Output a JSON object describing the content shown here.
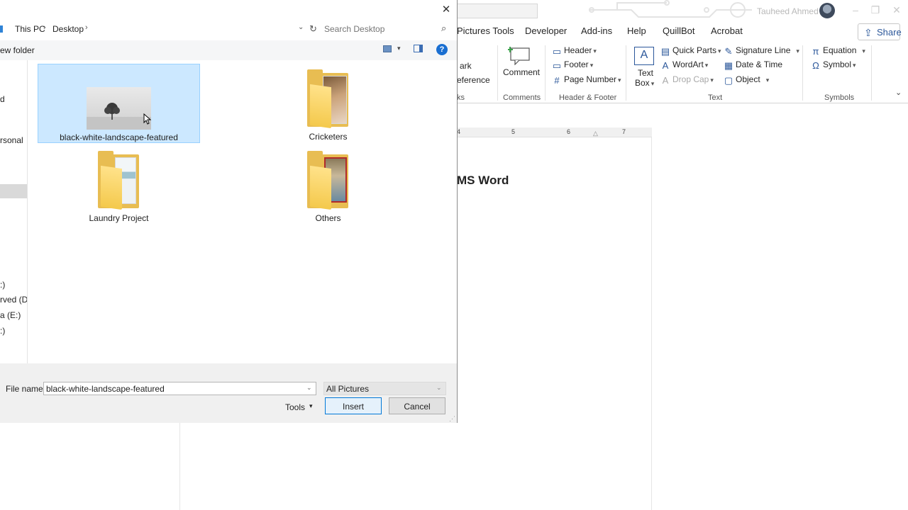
{
  "word": {
    "user_name": "Tauheed Ahmed",
    "tabs": [
      "Pictures Tools",
      "Developer",
      "Add-ins",
      "Help",
      "QuillBot",
      "Acrobat"
    ],
    "share_label": "Share",
    "ribbon": {
      "links_partial": [
        "ark",
        "eference",
        "ks"
      ],
      "comment_label": "Comment",
      "comments_group": "Comments",
      "header_label": "Header",
      "footer_label": "Footer",
      "page_number_label": "Page Number",
      "header_footer_group": "Header & Footer",
      "textbox_line1": "Text",
      "textbox_line2": "Box",
      "quick_parts_label": "Quick Parts",
      "wordart_label": "WordArt",
      "drop_cap_label": "Drop Cap",
      "signature_line_label": "Signature Line",
      "date_time_label": "Date & Time",
      "object_label": "Object",
      "text_group": "Text",
      "equation_label": "Equation",
      "symbol_label": "Symbol",
      "symbols_group": "Symbols"
    },
    "ruler_numbers": [
      "4",
      "5",
      "6",
      "7"
    ],
    "doc_heading": "MS Word"
  },
  "dialog": {
    "breadcrumb": [
      "This PC",
      "Desktop"
    ],
    "search_placeholder": "Search Desktop",
    "new_folder_label": "ew folder",
    "nav_items": [
      "d",
      "rsonal",
      ":)",
      "rved (D:",
      "a (E:)",
      ":)"
    ],
    "files": [
      {
        "name": "black-white-landscape-featured",
        "kind": "image",
        "selected": true
      },
      {
        "name": "Cricketers",
        "kind": "folder",
        "selected": false
      },
      {
        "name": "Laundry Project",
        "kind": "folder",
        "selected": false
      },
      {
        "name": "Others",
        "kind": "folder",
        "selected": false
      }
    ],
    "file_name_label": "File name:",
    "file_name_value": "black-white-landscape-featured",
    "file_type": "All Pictures",
    "tools_label": "Tools",
    "insert_label": "Insert",
    "cancel_label": "Cancel"
  },
  "colors": {
    "selection_bg": "#cce8ff",
    "accent": "#0078d7",
    "word_blue": "#2b579a",
    "folder_yellow": "#f4c94c"
  }
}
